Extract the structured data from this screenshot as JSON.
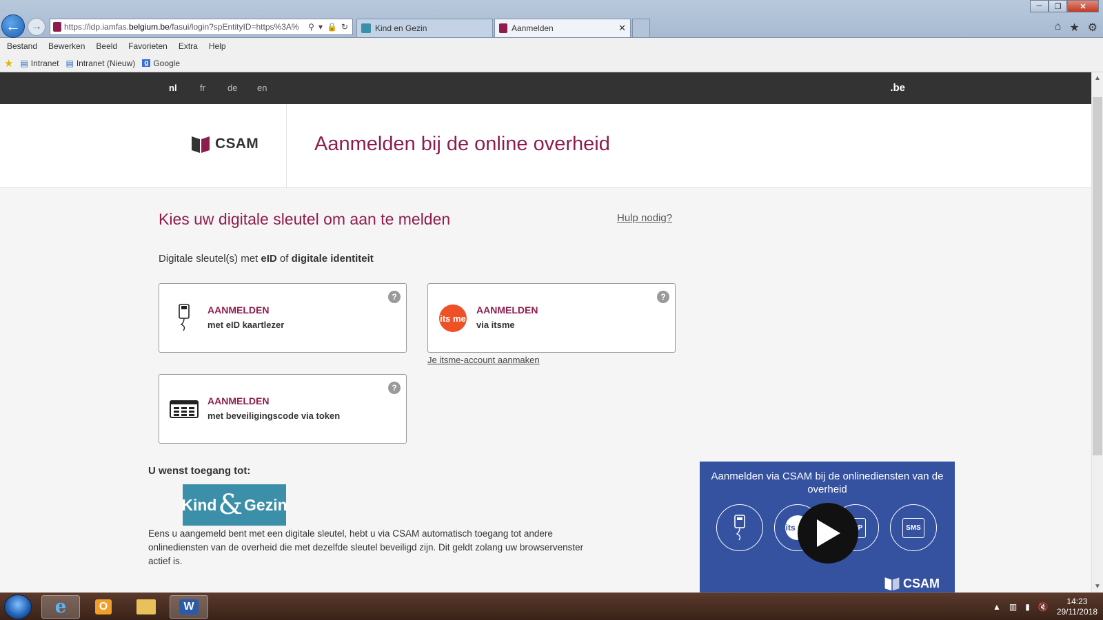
{
  "browser": {
    "address": {
      "prefix": "https://idp.iamfas.",
      "domain": "belgium.be",
      "suffix": "/fasui/login?spEntityID=https%3A%"
    },
    "tabs": [
      {
        "label": "Kind en Gezin",
        "active": false
      },
      {
        "label": "Aanmelden",
        "active": true
      }
    ],
    "menu": [
      "Bestand",
      "Bewerken",
      "Beeld",
      "Favorieten",
      "Extra",
      "Help"
    ],
    "favorites": [
      "Intranet",
      "Intranet (Nieuw)",
      "Google"
    ]
  },
  "page": {
    "languages": [
      "nl",
      "fr",
      "de",
      "en"
    ],
    "active_language": "nl",
    "be_logo": ".be",
    "logo_text": "CSAM",
    "title": "Aanmelden bij de online overheid",
    "section_title": "Kies uw digitale sleutel om aan te melden",
    "help_link": "Hulp nodig?",
    "subhead": {
      "pre": "Digitale sleutel(s) met ",
      "b1": "eID",
      "mid": " of ",
      "b2": "digitale identiteit"
    },
    "cards": {
      "eid": {
        "title": "AANMELDEN",
        "sub": "met eID kaartlezer"
      },
      "itsme": {
        "title": "AANMELDEN",
        "sub": "via itsme",
        "icon_text": "its me"
      },
      "token": {
        "title": "AANMELDEN",
        "sub": "met beveiligingscode via token"
      }
    },
    "itsme_create": "Je itsme-account aanmaken",
    "access_label": "U wenst toegang tot:",
    "kg_logo": {
      "left": "Kind",
      "amp": "&",
      "right": "Gezin"
    },
    "info_text": "Eens u aangemeld bent met een digitale sleutel, hebt u via CSAM automatisch toegang tot andere onlinediensten van de overheid die met dezelfde sleutel beveiligd zijn. Dit geldt zolang uw browservenster actief is.",
    "video": {
      "title": "Aanmelden via CSAM bij de onlinediensten van de overheid",
      "logo": "CSAM",
      "icons": [
        "card-reader",
        "itsme",
        "app",
        "sms"
      ],
      "icon_labels": {
        "itsme": "its me",
        "app": "APP",
        "sms": "SMS"
      }
    }
  },
  "taskbar": {
    "apps": [
      "internet-explorer",
      "outlook",
      "file-explorer",
      "word"
    ],
    "time": "14:23",
    "date": "29/11/2018"
  },
  "colors": {
    "brand": "#8e1d4d",
    "langbar": "#333333",
    "video_bg": "#3552a0",
    "kg": "#3b8fa9",
    "itsme": "#ef5127"
  }
}
